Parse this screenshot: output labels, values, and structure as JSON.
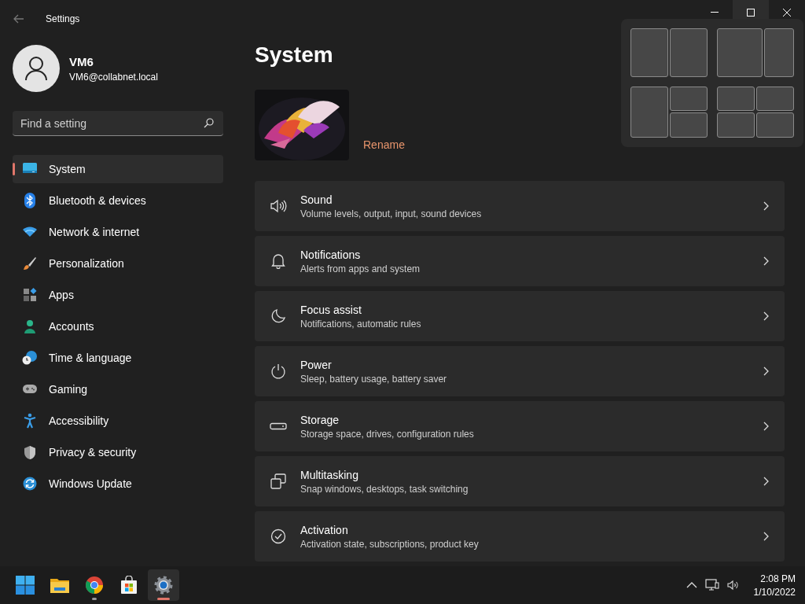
{
  "window": {
    "title": "Settings"
  },
  "user": {
    "name": "VM6",
    "email": "VM6@collabnet.local"
  },
  "search": {
    "placeholder": "Find a setting"
  },
  "sidebar": {
    "items": [
      {
        "label": "System",
        "selected": true
      },
      {
        "label": "Bluetooth & devices",
        "selected": false
      },
      {
        "label": "Network & internet",
        "selected": false
      },
      {
        "label": "Personalization",
        "selected": false
      },
      {
        "label": "Apps",
        "selected": false
      },
      {
        "label": "Accounts",
        "selected": false
      },
      {
        "label": "Time & language",
        "selected": false
      },
      {
        "label": "Gaming",
        "selected": false
      },
      {
        "label": "Accessibility",
        "selected": false
      },
      {
        "label": "Privacy & security",
        "selected": false
      },
      {
        "label": "Windows Update",
        "selected": false
      }
    ]
  },
  "page": {
    "title": "System",
    "device": {
      "kind": "picture",
      "action": "Rename"
    },
    "cards": [
      {
        "title": "Sound",
        "subtitle": "Volume levels, output, input, sound devices"
      },
      {
        "title": "Notifications",
        "subtitle": "Alerts from apps and system"
      },
      {
        "title": "Focus assist",
        "subtitle": "Notifications, automatic rules"
      },
      {
        "title": "Power",
        "subtitle": "Sleep, battery usage, battery saver"
      },
      {
        "title": "Storage",
        "subtitle": "Storage space, drives, configuration rules"
      },
      {
        "title": "Multitasking",
        "subtitle": "Snap windows, desktops, task switching"
      },
      {
        "title": "Activation",
        "subtitle": "Activation state, subscriptions, product key"
      }
    ]
  },
  "snap_layouts": {
    "open": true
  },
  "taskbar": {
    "apps": [
      {
        "running": false,
        "selected": false
      },
      {
        "running": false,
        "selected": false
      },
      {
        "running": true,
        "selected": false
      },
      {
        "running": false,
        "selected": false
      },
      {
        "running": true,
        "selected": true
      }
    ],
    "clock": {
      "time": "2:08 PM",
      "date": "1/10/2022"
    }
  }
}
